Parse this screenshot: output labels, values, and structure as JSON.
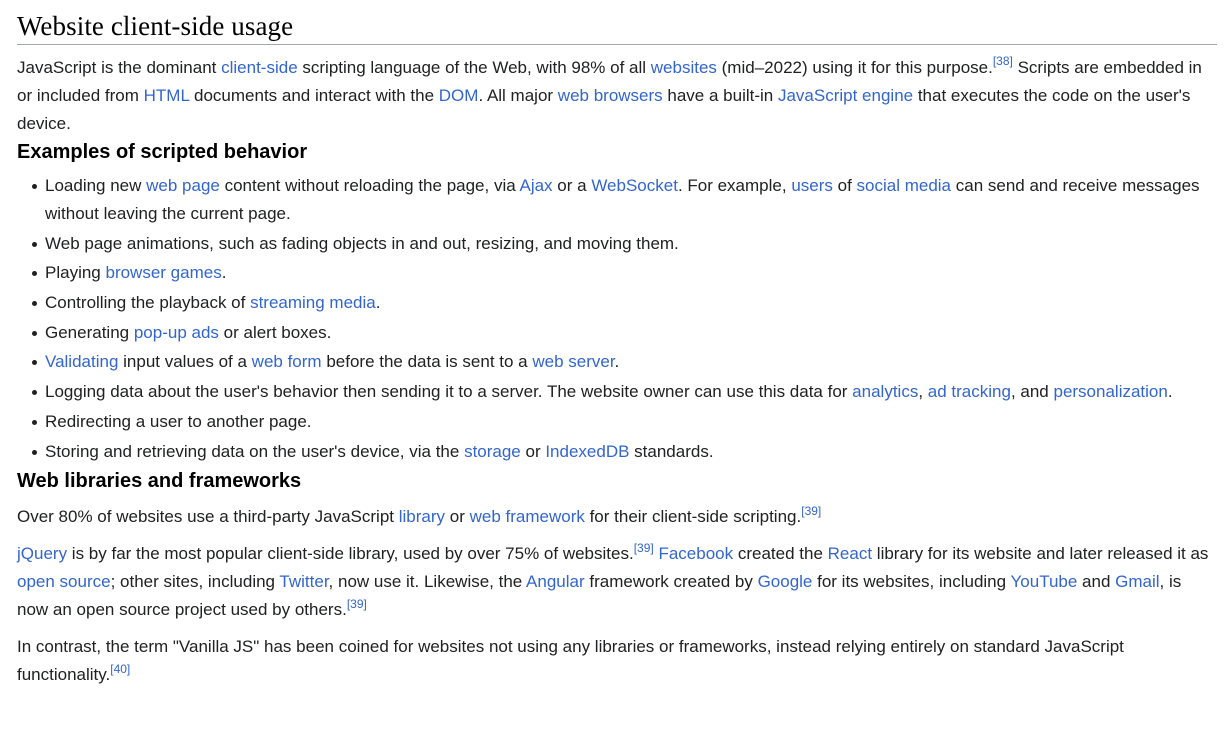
{
  "section": {
    "title": "Website client-side usage"
  },
  "intro": {
    "t1": "JavaScript is the dominant ",
    "l1": "client-side",
    "t2": " scripting language of the Web, with 98% of all ",
    "l2": "websites",
    "t3": " (mid–2022) using it for this purpose.",
    "r1": "[38]",
    "t4": " Scripts are embedded in or included from ",
    "l3": "HTML",
    "t5": " documents and interact with the ",
    "l4": "DOM",
    "t6": ". All major ",
    "l5": "web browsers",
    "t7": " have a built-in ",
    "l6": "JavaScript engine",
    "t8": " that executes the code on the user's device."
  },
  "examples": {
    "heading": "Examples of scripted behavior",
    "items": [
      {
        "t1": "Loading new ",
        "l1": "web page",
        "t2": " content without reloading the page, via ",
        "l2": "Ajax",
        "t3": " or a ",
        "l3": "WebSocket",
        "t4": ". For example, ",
        "l4": "users",
        "t5": " of ",
        "l5": "social media",
        "t6": " can send and receive messages without leaving the current page."
      },
      {
        "t1": "Web page animations, such as fading objects in and out, resizing, and moving them."
      },
      {
        "t1": "Playing ",
        "l1": "browser games",
        "t2": "."
      },
      {
        "t1": "Controlling the playback of ",
        "l1": "streaming media",
        "t2": "."
      },
      {
        "t1": "Generating ",
        "l1": "pop-up ads",
        "t2": " or alert boxes."
      },
      {
        "l1": "Validating",
        "t1": " input values of a ",
        "l2": "web form",
        "t2": " before the data is sent to a ",
        "l3": "web server",
        "t3": "."
      },
      {
        "t1": "Logging data about the user's behavior then sending it to a server. The website owner can use this data for ",
        "l1": "analytics",
        "t2": ", ",
        "l2": "ad tracking",
        "t3": ", and ",
        "l3": "personalization",
        "t4": "."
      },
      {
        "t1": "Redirecting a user to another page."
      },
      {
        "t1": "Storing and retrieving data on the user's device, via the ",
        "l1": "storage",
        "t2": " or ",
        "l2": "IndexedDB",
        "t3": " standards."
      }
    ]
  },
  "libraries": {
    "heading": "Web libraries and frameworks",
    "p1": {
      "t1": "Over 80% of websites use a third-party JavaScript ",
      "l1": "library",
      "t2": " or ",
      "l2": "web framework",
      "t3": " for their client-side scripting.",
      "r1": "[39]"
    },
    "p2": {
      "l1": "jQuery",
      "t1": " is by far the most popular client-side library, used by over 75% of websites.",
      "r1": "[39]",
      "t2": " ",
      "l2": "Facebook",
      "t3": " created the ",
      "l3": "React",
      "t4": " library for its website and later released it as ",
      "l4": "open source",
      "t5": "; other sites, including ",
      "l5": "Twitter",
      "t6": ", now use it. Likewise, the ",
      "l6": "Angular",
      "t7": " framework created by ",
      "l7": "Google",
      "t8": " for its websites, including ",
      "l8": "YouTube",
      "t9": " and ",
      "l9": "Gmail",
      "t10": ", is now an open source project used by others.",
      "r2": "[39]"
    },
    "p3": {
      "t1": "In contrast, the term \"Vanilla JS\" has been coined for websites not using any libraries or frameworks, instead relying entirely on standard JavaScript functionality.",
      "r1": "[40]"
    }
  },
  "colors": {
    "link": "#3366cc",
    "text": "#202122",
    "rule": "#a2a9b1"
  }
}
